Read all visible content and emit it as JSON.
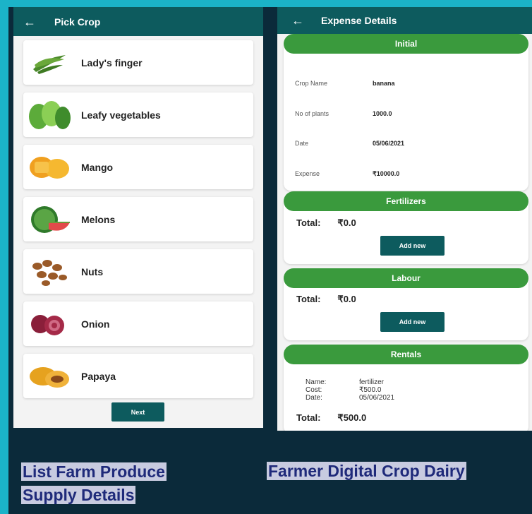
{
  "left_screen": {
    "title": "Pick Crop",
    "items": [
      {
        "label": "Lady's finger",
        "icon": "okra-icon"
      },
      {
        "label": "Leafy vegetables",
        "icon": "leafy-icon"
      },
      {
        "label": "Mango",
        "icon": "mango-icon"
      },
      {
        "label": "Melons",
        "icon": "melon-icon"
      },
      {
        "label": "Nuts",
        "icon": "nuts-icon"
      },
      {
        "label": "Onion",
        "icon": "onion-icon"
      },
      {
        "label": "Papaya",
        "icon": "papaya-icon"
      }
    ],
    "next_label": "Next"
  },
  "right_screen": {
    "title": "Expense Details",
    "initial": {
      "header": "Initial",
      "rows": [
        {
          "key": "Crop Name",
          "value": "banana"
        },
        {
          "key": "No of plants",
          "value": "1000.0"
        },
        {
          "key": "Date",
          "value": "05/06/2021"
        },
        {
          "key": "Expense",
          "value": "₹10000.0"
        }
      ]
    },
    "fertilizers": {
      "header": "Fertilizers",
      "total_label": "Total:",
      "total_value": "₹0.0",
      "button": "Add new"
    },
    "labour": {
      "header": "Labour",
      "total_label": "Total:",
      "total_value": "₹0.0",
      "button": "Add new"
    },
    "rentals": {
      "header": "Rentals",
      "name_key": "Name:",
      "name_value": "fertilizer",
      "cost_key": "Cost:",
      "cost_value": "₹500.0",
      "date_key": "Date:",
      "date_value": "05/06/2021",
      "total_label": "Total:",
      "total_value": "₹500.0"
    }
  },
  "captions": {
    "left_line1": "List Farm Produce",
    "left_line2": "Supply Details",
    "right": "Farmer Digital Crop Dairy"
  },
  "colors": {
    "appbar": "#0d5b5e",
    "section_green": "#3a9a3d",
    "caption_text": "#1f2a7a"
  }
}
